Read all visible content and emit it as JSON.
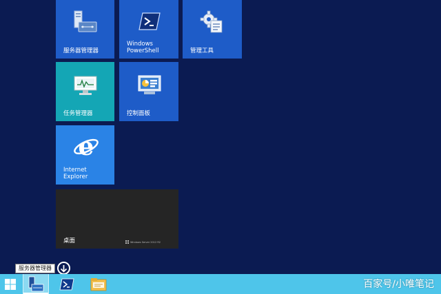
{
  "tiles": {
    "server_manager": "服务器管理器",
    "powershell": "Windows\nPowerShell",
    "admin_tools": "管理工具",
    "task_manager": "任务管理器",
    "control_panel": "控制面板",
    "ie": "Internet\nExplorer",
    "desktop": "桌面",
    "desktop_edition": "Windows Server 2012 R2"
  },
  "tooltip": "服务器管理器",
  "watermark": "百家号/小唯笔记",
  "icons": {
    "start": "windows-logo-icon",
    "server_manager": "server-manager-icon",
    "powershell": "powershell-icon",
    "admin_tools": "gear-tools-icon",
    "task_manager": "task-manager-icon",
    "control_panel": "control-panel-icon",
    "ie": "internet-explorer-icon",
    "explorer": "folder-icon",
    "scroll": "arrow-down-circle-icon"
  },
  "colors": {
    "background": "#0b1b52",
    "tile_blue": "#1e5cc8",
    "tile_teal": "#14a6b5",
    "tile_ie": "#2a83e6",
    "tile_desktop": "#252525",
    "taskbar": "#4ec5ea"
  }
}
